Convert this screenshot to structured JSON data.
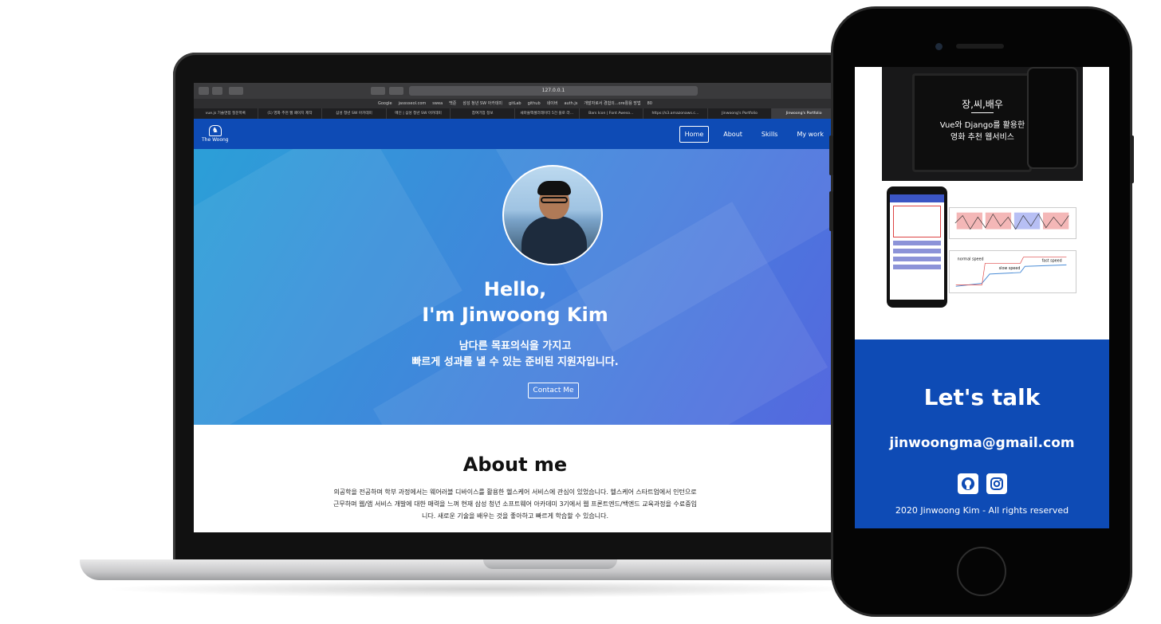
{
  "browser": {
    "address": "127.0.0.1",
    "bookmarks": [
      "Google",
      "jasssseol.com",
      "swea",
      "백준",
      "삼성 청년 SW 아카데미",
      "gitLab",
      "github",
      "네이버",
      "auth.js",
      "개발자로서 경험의...ore활용 방법",
      "80"
    ],
    "tabs": [
      {
        "label": "vue.js 기술면접 질문목록",
        "active": false
      },
      {
        "label": "(1) 영화 추천 웹 페이지 제작",
        "active": false
      },
      {
        "label": "삼성 청년 SW 아카데미",
        "active": false
      },
      {
        "label": "메인 | 삼성 청년 SW 아카데미",
        "active": false
      },
      {
        "label": "참여기업 정보",
        "active": false
      },
      {
        "label": "새마을엑셀러레이터 5건 블로 라…",
        "active": false
      },
      {
        "label": "Bars Icon | Font Aweso…",
        "active": false
      },
      {
        "label": "https://s3.amazonaws.c…",
        "active": false
      },
      {
        "label": "Jinwoong's Portfolio",
        "active": false
      },
      {
        "label": "Jinwoong's Portfolio",
        "active": true
      }
    ]
  },
  "site": {
    "logo_text": "The Woong",
    "nav": [
      "Home",
      "About",
      "Skills",
      "My work"
    ],
    "hero": {
      "hello_line1": "Hello,",
      "hello_line2": "I'm Jinwoong Kim",
      "sub_line1": "남다른 목표의식을 가지고",
      "sub_line2": "빠르게 성과를 낼 수 있는 준비된 지원자입니다.",
      "button": "Contact Me"
    },
    "about": {
      "title": "About me",
      "text": "의공학을 전공하며 학부 과정에서는 웨어러블 디바이스를 활용한 헬스케어 서비스에 관심이 있었습니다. 헬스케어 스타트업에서 인턴으로 근무하며 웹/앱 서비스 개발에 대한 매력을 느껴 현재 삼성 청년 소프트웨어 아카데미 3기에서 웹 프론트엔드/백엔드 교육과정을 수료중입니다. 새로운 기술을 배우는 것을 좋아하고 빠르게 학습할 수 있습니다."
    }
  },
  "mobile": {
    "project1": {
      "title": "장,씨,배우",
      "desc_line1": "Vue와 Django를 활용한",
      "desc_line2": "영화 추천 웹서비스"
    },
    "project2": {
      "chart_labels": [
        "normal speed",
        "slow speed",
        "fast speed"
      ]
    },
    "contact": {
      "title": "Let's talk",
      "email": "jinwoongma@gmail.com",
      "copyright": "2020 Jinwoong Kim - All rights reserved"
    }
  },
  "colors": {
    "brand_blue": "#0e4bb5",
    "hero_gradient_start": "#2b9fd8",
    "hero_gradient_end": "#5568df"
  }
}
